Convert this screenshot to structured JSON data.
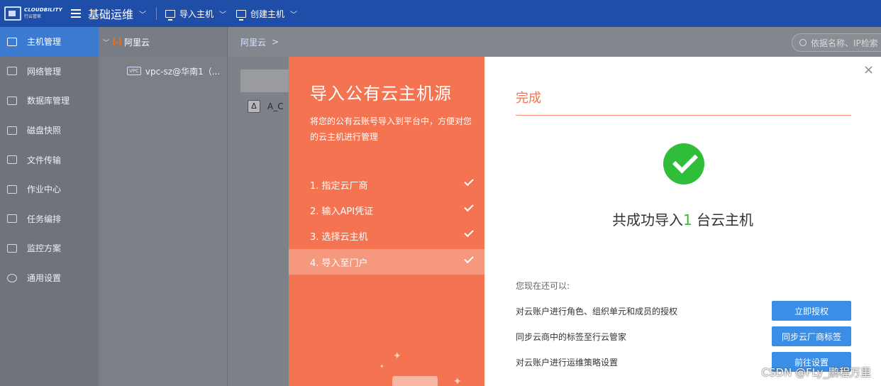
{
  "topbar": {
    "logo_en": "CLOUDBILITY",
    "logo_cn": "行云管家",
    "app_title": "基础运维",
    "import_host": "导入主机",
    "create_host": "创建主机"
  },
  "sidebar": {
    "items": [
      {
        "label": "主机管理",
        "icon": "monitor-icon"
      },
      {
        "label": "网络管理",
        "icon": "network-icon"
      },
      {
        "label": "数据库管理",
        "icon": "database-icon"
      },
      {
        "label": "磁盘快照",
        "icon": "camera-icon"
      },
      {
        "label": "文件传输",
        "icon": "file-transfer-icon"
      },
      {
        "label": "作业中心",
        "icon": "job-icon"
      },
      {
        "label": "任务编排",
        "icon": "task-icon"
      },
      {
        "label": "监控方案",
        "icon": "monitor-chart-icon"
      },
      {
        "label": "通用设置",
        "icon": "gear-icon"
      }
    ]
  },
  "tree": {
    "provider_logo": "(-)",
    "provider": "阿里云",
    "vpc_badge": "VPC",
    "vpc_item": "vpc-sz@华南1（..."
  },
  "main": {
    "breadcrumb": "阿里云",
    "breadcrumb_arrow": ">",
    "search_placeholder": "依据名称、IP检索",
    "row_name": "A_C"
  },
  "modal": {
    "left": {
      "title": "导入公有云主机源",
      "subtitle": "将您的公有云账号导入到平台中，方便对您的云主机进行管理",
      "steps": [
        {
          "label": "1. 指定云厂商",
          "done": true
        },
        {
          "label": "2. 输入API凭证",
          "done": true
        },
        {
          "label": "3. 选择云主机",
          "done": true
        },
        {
          "label": "4. 导入至门户",
          "done": true,
          "active": true
        }
      ]
    },
    "right": {
      "close": "×",
      "title": "完成",
      "result_prefix": "共成功导入",
      "result_count": "1",
      "result_suffix": " 台云主机",
      "can_do": "您现在还可以:",
      "actions": [
        {
          "text": "对云账户进行角色、组织单元和成员的授权",
          "button": "立即授权"
        },
        {
          "text": "同步云商中的标签至行云管家",
          "button": "同步云厂商标签"
        },
        {
          "text": "对云账户进行运维策略设置",
          "button": "前往设置"
        }
      ]
    }
  },
  "watermark": "CSDN @FLy_鹏程万里",
  "colors": {
    "topbar": "#1f4ea8",
    "modal_accent": "#f47351",
    "success": "#2fbd3a",
    "button": "#3a8ee6"
  }
}
